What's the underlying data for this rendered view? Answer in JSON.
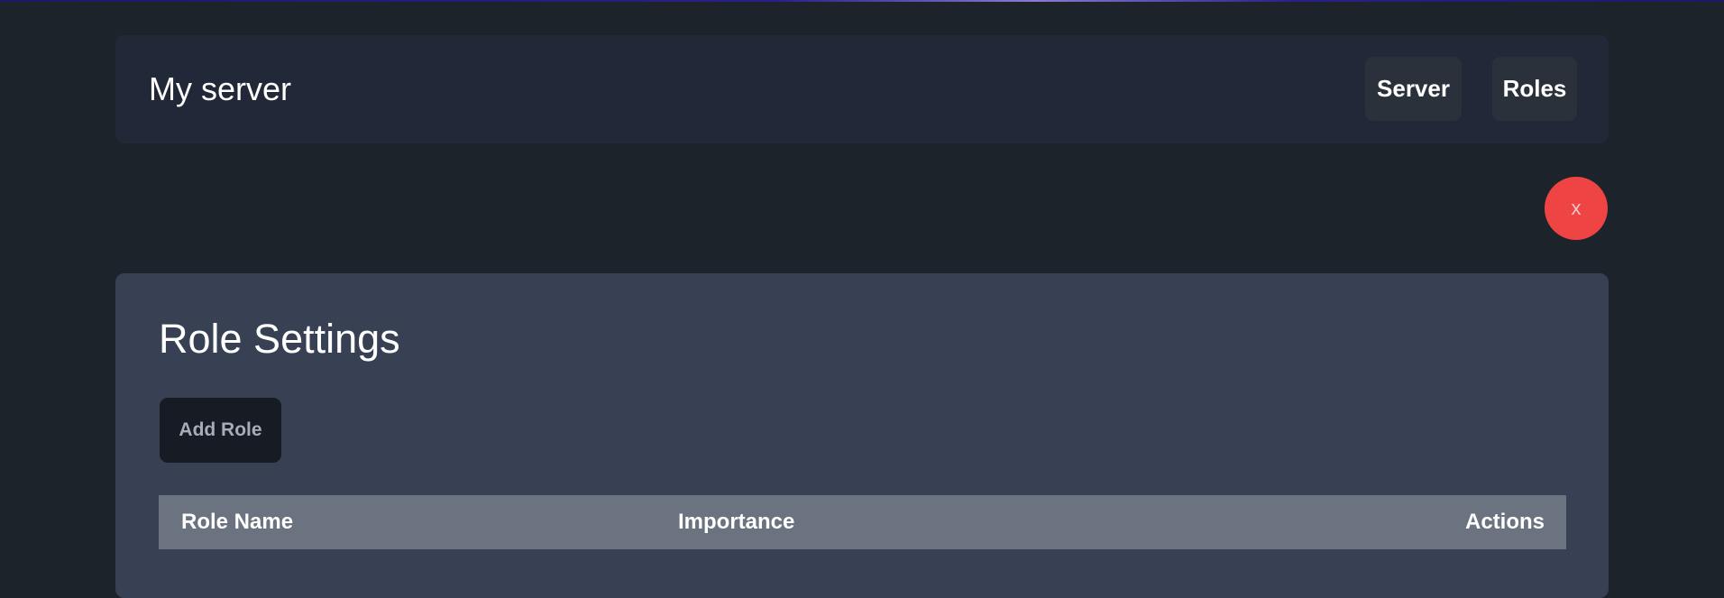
{
  "header": {
    "title": "My server",
    "nav": {
      "server_label": "Server",
      "roles_label": "Roles"
    }
  },
  "close_button": {
    "label": "x",
    "color": "#ef4444"
  },
  "role_settings": {
    "title": "Role Settings",
    "add_role_label": "Add Role",
    "table": {
      "columns": [
        "Role Name",
        "Importance",
        "Actions"
      ],
      "rows": []
    }
  },
  "colors": {
    "background": "#1d232b",
    "header_bg": "#212938",
    "panel_bg": "#384153",
    "table_header_bg": "#6b7280",
    "button_dark": "#171b23"
  }
}
